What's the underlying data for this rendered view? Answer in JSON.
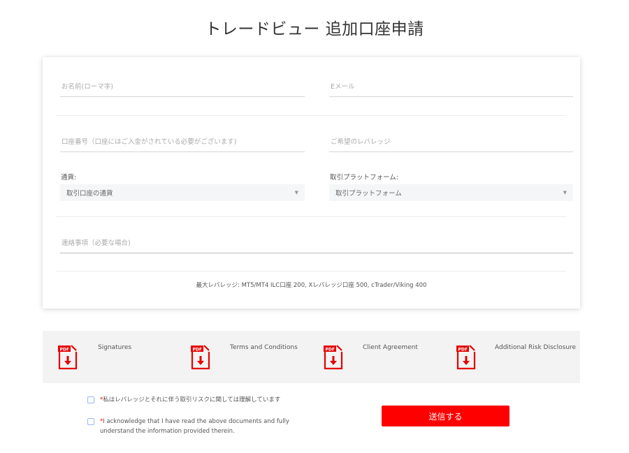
{
  "page": {
    "title": "トレードビュー 追加口座申請"
  },
  "form": {
    "name_placeholder": "お名前(ローマ字)",
    "email_placeholder": "Eメール",
    "account_number_placeholder": "口座番号（口座にはご入金がされている必要がございます)",
    "leverage_placeholder": "ご希望のレバレッジ",
    "currency_label": "通貨:",
    "currency_value": "取引口座の通貨",
    "platform_label": "取引プラットフォーム:",
    "platform_value": "取引プラットフォーム",
    "notes_placeholder": "連絡事項（必要な場合)",
    "leverage_note": "最大レバレッジ: MT5/MT4 ILC口座 200, Xレバレッジ口座 500, cTrader/Viking 400"
  },
  "documents": [
    {
      "label": "Signatures",
      "icon": "pdf-download-icon"
    },
    {
      "label": "Terms and Conditions",
      "icon": "pdf-download-icon"
    },
    {
      "label": "Client Agreement",
      "icon": "pdf-download-icon"
    },
    {
      "label": "Additional Risk Disclosure",
      "icon": "pdf-download-icon"
    }
  ],
  "consents": {
    "risk_asterisk": "*",
    "risk_text": "私はレバレッジとそれに伴う取引リスクに関しては理解しています",
    "ack_asterisk": "*",
    "ack_text": "I acknowledge that I have read the above documents and fully understand the information provided therein."
  },
  "submit": {
    "label": "送信する"
  },
  "colors": {
    "accent": "#ff0000",
    "checkbox_border": "#9cb6ff",
    "docs_bar_bg": "#f3f3f3"
  }
}
